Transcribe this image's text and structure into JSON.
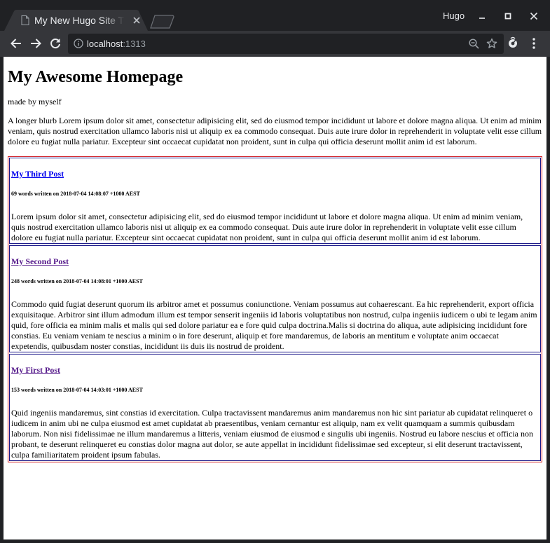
{
  "browser": {
    "tab_title": "My New Hugo Site Th",
    "profile_name": "Hugo",
    "url_host": "localhost",
    "url_port": ":1313",
    "colors": {
      "frame": "#202124",
      "toolbar": "#35363a",
      "text": "#e8eaed"
    },
    "icons": [
      "document-icon",
      "tab-close-icon",
      "new-tab-icon",
      "minimize-icon",
      "maximize-icon",
      "window-close-icon",
      "back-arrow-icon",
      "forward-arrow-icon",
      "reload-icon",
      "info-icon",
      "zoom-out-icon",
      "star-icon",
      "extension-icon",
      "menu-dots-icon"
    ]
  },
  "page": {
    "title": "My Awesome Homepage",
    "tagline": "made by myself",
    "blurb": "A longer blurb Lorem ipsum dolor sit amet, consectetur adipisicing elit, sed do eiusmod tempor incididunt ut labore et dolore magna aliqua. Ut enim ad minim veniam, quis nostrud exercitation ullamco laboris nisi ut aliquip ex ea commodo consequat. Duis aute irure dolor in reprehenderit in voluptate velit esse cillum dolore eu fugiat nulla pariatur. Excepteur sint occaecat cupidatat non proident, sunt in culpa qui officia deserunt mollit anim id est laborum.",
    "colors": {
      "outer_border": "#d3242a",
      "post_border": "#1c1a8a",
      "link": "#0000ee",
      "visited_link": "#551a8b"
    },
    "posts": [
      {
        "title": "My Third Post",
        "meta": "69 words written on 2018-07-04 14:08:07 +1000 AEST",
        "body": "Lorem ipsum dolor sit amet, consectetur adipisicing elit, sed do eiusmod tempor incididunt ut labore et dolore magna aliqua. Ut enim ad minim veniam, quis nostrud exercitation ullamco laboris nisi ut aliquip ex ea commodo consequat. Duis aute irure dolor in reprehenderit in voluptate velit esse cillum dolore eu fugiat nulla pariatur. Excepteur sint occaecat cupidatat non proident, sunt in culpa qui officia deserunt mollit anim id est laborum."
      },
      {
        "title": "My Second Post",
        "meta": "248 words written on 2018-07-04 14:08:01 +1000 AEST",
        "body": "Commodo quid fugiat deserunt quorum iis arbitror amet et possumus coniunctione. Veniam possumus aut cohaerescant. Ea hic reprehenderit, export officia exquisitaque. Arbitror sint illum admodum illum est tempor senserit ingeniis id laboris voluptatibus non nostrud, culpa ingeniis iudicem o ubi te legam anim quid, fore officia ea minim malis et malis qui sed dolore pariatur ea e fore quid culpa doctrina.Malis si doctrina do aliqua, aute adipisicing incididunt fore constias. Eu veniam veniam te nescius a minim o in fore deserunt, aliquip et fore mandaremus, de laboris an mentitum e voluptate anim occaecat expetendis, quibusdam noster constias, incididunt iis duis iis nostrud de proident."
      },
      {
        "title": "My First Post",
        "meta": "153 words written on 2018-07-04 14:03:01 +1000 AEST",
        "body": "Quid ingeniis mandaremus, sint constias id exercitation. Culpa tractavissent mandaremus anim mandaremus non hic sint pariatur ab cupidatat relinqueret o iudicem in anim ubi ne culpa eiusmod est amet cupidatat ab praesentibus, veniam cernantur est aliquip, nam ex velit quamquam a summis quibusdam laborum. Non nisi fidelissimae ne illum mandaremus a litteris, veniam eiusmod de eiusmod e singulis ubi ingeniis. Nostrud eu labore nescius et officia non probant, te deserunt relinqueret eu constias dolor magna aut dolor, se aute appellat in incididunt fidelissimae sed excepteur, si elit deserunt tractavissent, culpa familiaritatem proident ipsum fabulas."
      }
    ]
  }
}
